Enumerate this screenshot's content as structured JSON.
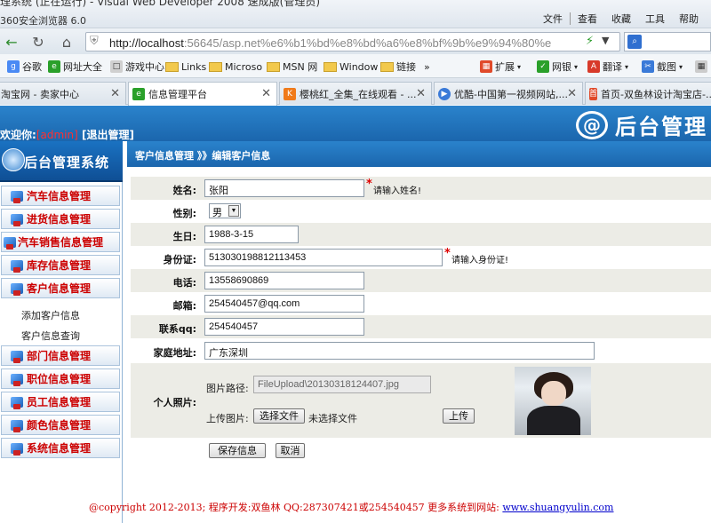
{
  "browser": {
    "title_cut": "理系统 (正在运行) - Visual Web Developer 2008 速成版(管理员)",
    "name": "360安全浏览器 6.0",
    "menu": [
      "文件",
      "查看",
      "收藏",
      "工具",
      "帮助"
    ],
    "url_host": "http://localhost",
    "url_rest": ":56645/asp.net%e6%b1%bd%e8%bd%a6%e8%bf%9b%e9%94%80%e",
    "favorites": [
      "谷歌",
      "网址大全",
      "游戏中心",
      "Links",
      "Microso",
      "MSN 网",
      "Window",
      "链接"
    ],
    "fav_more": "»",
    "toolbar_right": [
      "扩展",
      "网银",
      "翻译",
      "截图"
    ],
    "tabs": [
      {
        "label": "淘宝网 - 卖家中心",
        "active": false
      },
      {
        "label": "信息管理平台",
        "active": true
      },
      {
        "label": "樱桃红_全集_在线观看 - ...",
        "active": false
      },
      {
        "label": "优酷-中国第一视频网站,...",
        "active": false
      },
      {
        "label": "首页-双鱼林设计淘宝店-...",
        "active": false
      }
    ]
  },
  "header": {
    "welcome_prefix": "欢迎你:",
    "user": "[admin]",
    "logout": "[退出管理]",
    "logo_symbol": "@",
    "logo_text": "后台管理"
  },
  "sidebar": {
    "title": "后台管理系统",
    "items_top": [
      "汽车信息管理",
      "进货信息管理",
      "汽车销售信息管理",
      "库存信息管理",
      "客户信息管理"
    ],
    "subitems": [
      "添加客户信息",
      "客户信息查询"
    ],
    "items_bottom": [
      "部门信息管理",
      "职位信息管理",
      "员工信息管理",
      "颜色信息管理",
      "系统信息管理"
    ]
  },
  "breadcrumb": "客户信息管理 》》编辑客户信息",
  "form": {
    "name_label": "姓名:",
    "name_value": "张阳",
    "name_hint": "请输入姓名!",
    "gender_label": "性别:",
    "gender_value": "男",
    "birthday_label": "生日:",
    "birthday_value": "1988-3-15",
    "idcard_label": "身份证:",
    "idcard_value": "513030198812113453",
    "idcard_hint": "请输入身份证!",
    "phone_label": "电话:",
    "phone_value": "13558690869",
    "email_label": "邮箱:",
    "email_value": "254540457@qq.com",
    "qq_label": "联系qq:",
    "qq_value": "254540457",
    "address_label": "家庭地址:",
    "address_value": "广东深圳",
    "photo_label": "个人照片:",
    "photo_path_label": "图片路径:",
    "photo_path_value": "FileUpload\\20130318124407.jpg",
    "upload_label": "上传图片:",
    "choose_file": "选择文件",
    "no_file": "未选择文件",
    "upload_btn": "上传",
    "save_btn": "保存信息",
    "cancel_btn": "取消",
    "required_mark": "*"
  },
  "footer": {
    "text": "@copyright 2012-2013; 程序开发:双鱼林  QQ:287307421或254540457  更多系统到网站:",
    "link": "www.shuangyulin.com"
  },
  "colors": {
    "accent": "#1b66ad",
    "menu_red": "#cc0000",
    "row_alt": "#ecece6"
  }
}
